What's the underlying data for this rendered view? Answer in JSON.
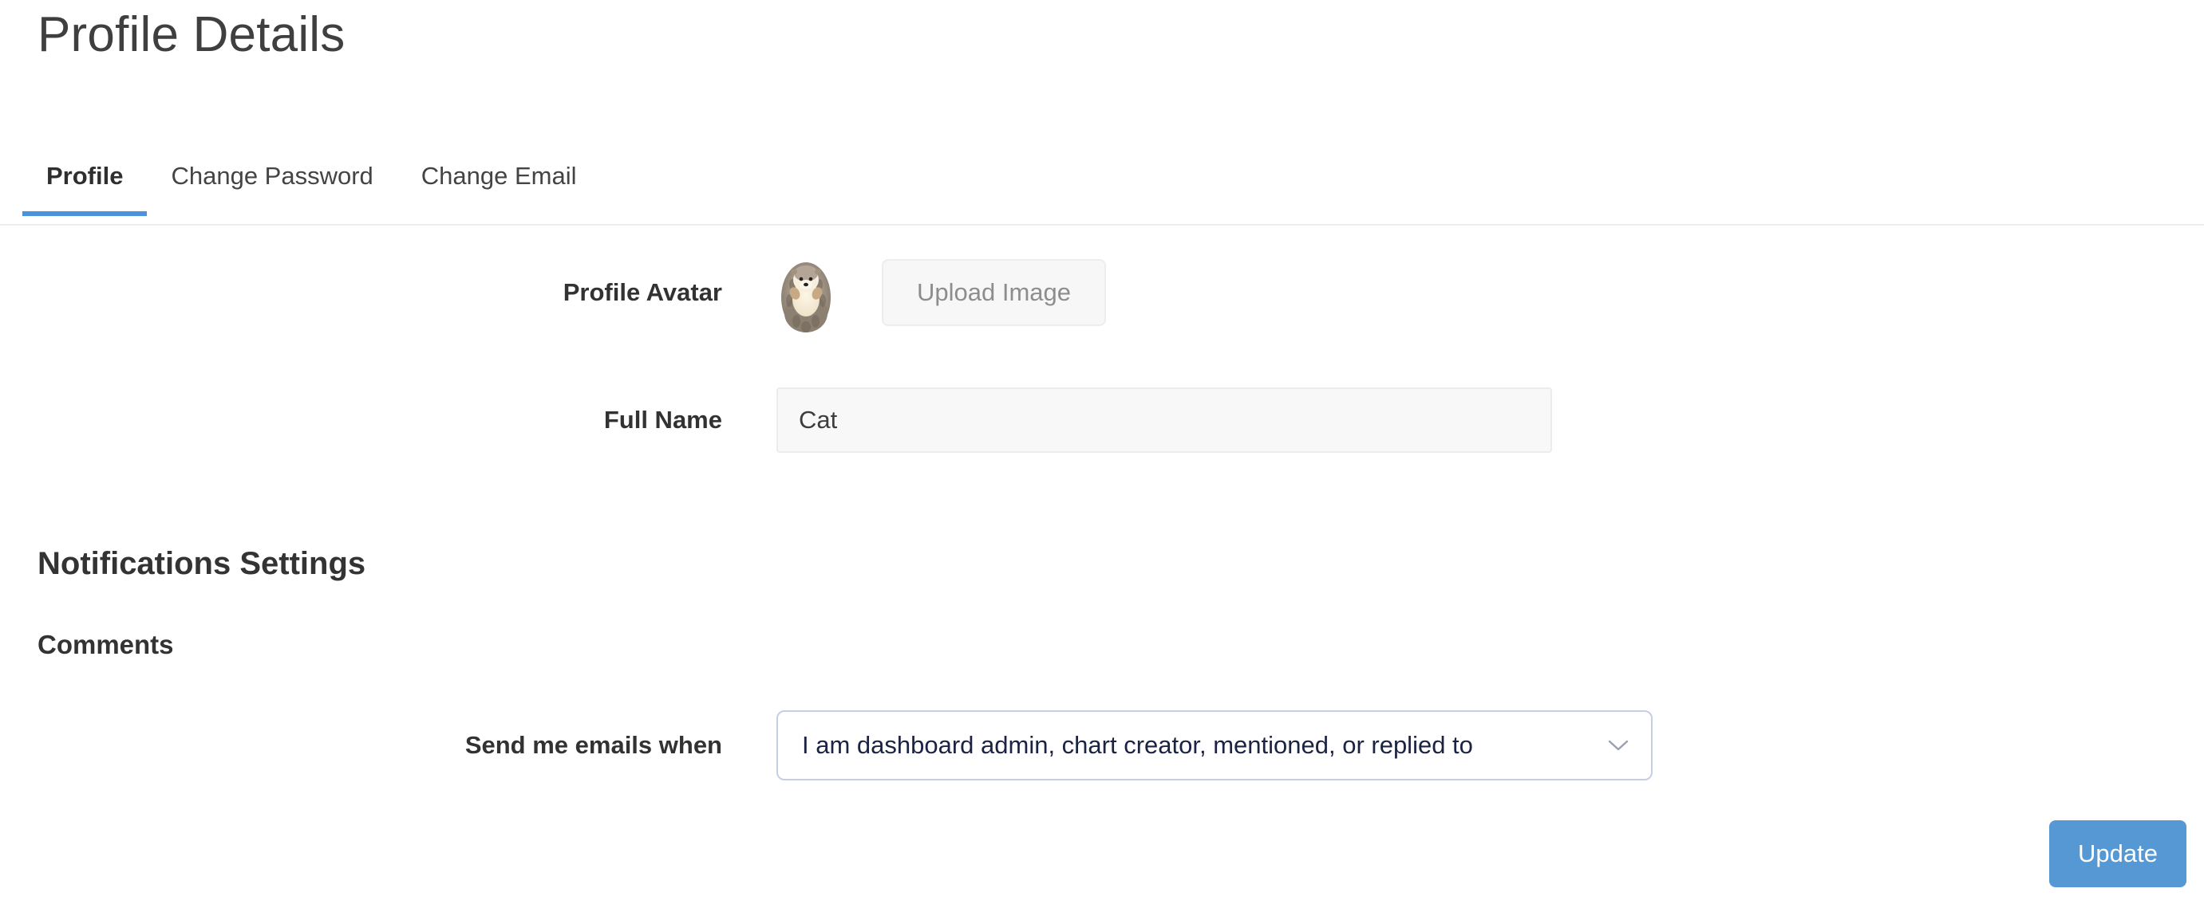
{
  "page": {
    "title": "Profile Details"
  },
  "tabs": [
    {
      "label": "Profile",
      "active": true
    },
    {
      "label": "Change Password",
      "active": false
    },
    {
      "label": "Change Email",
      "active": false
    }
  ],
  "form": {
    "avatar": {
      "label": "Profile Avatar",
      "image_alt": "hedgehog-plush-avatar",
      "upload_button": "Upload Image"
    },
    "full_name": {
      "label": "Full Name",
      "value": "Cat",
      "placeholder": ""
    }
  },
  "notifications": {
    "heading": "Notifications Settings",
    "comments_heading": "Comments",
    "send_emails": {
      "label": "Send me emails when",
      "selected": "I am dashboard admin, chart creator, mentioned, or replied to",
      "chevron_icon": "chevron-down-icon"
    }
  },
  "actions": {
    "update_label": "Update"
  },
  "colors": {
    "accent_blue": "#4b93dc",
    "button_blue": "#5598d4",
    "select_border": "#c7cee1",
    "input_bg": "#f8f8f8",
    "divider": "#ececec",
    "text_dark": "#333333",
    "select_text": "#1b2343"
  }
}
